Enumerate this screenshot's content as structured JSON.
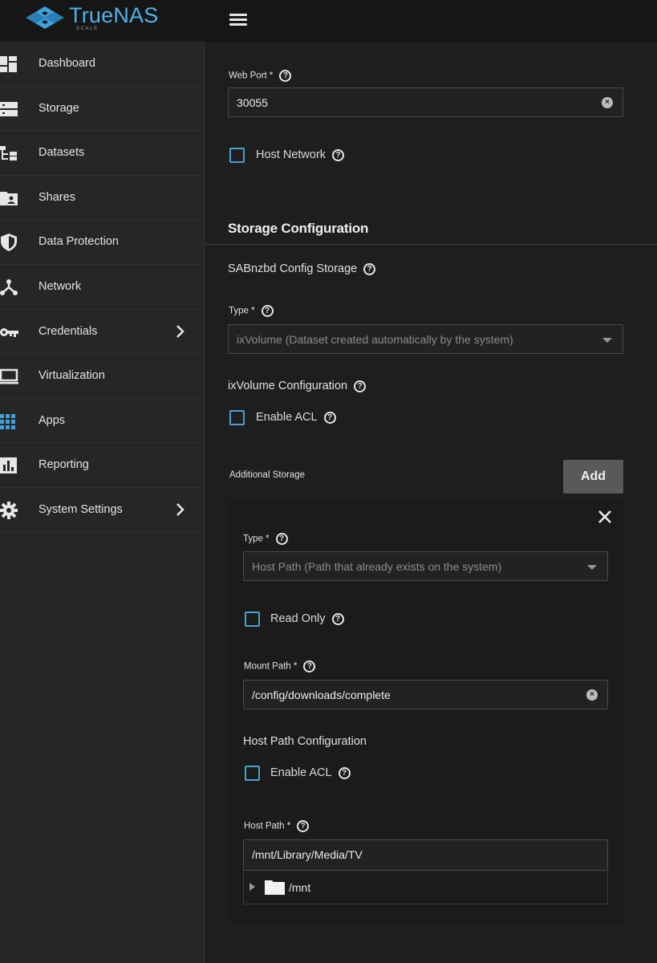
{
  "brand": {
    "name": "TrueNAS",
    "edition": "SCALE",
    "accent": "#4fb1e6"
  },
  "sidebar": {
    "items": [
      {
        "label": "Dashboard",
        "icon": "dashboard-icon"
      },
      {
        "label": "Storage",
        "icon": "storage-icon"
      },
      {
        "label": "Datasets",
        "icon": "datasets-icon"
      },
      {
        "label": "Shares",
        "icon": "shares-folder-icon"
      },
      {
        "label": "Data Protection",
        "icon": "shield-icon"
      },
      {
        "label": "Network",
        "icon": "network-icon"
      },
      {
        "label": "Credentials",
        "icon": "key-icon",
        "has_submenu": true
      },
      {
        "label": "Virtualization",
        "icon": "laptop-icon"
      },
      {
        "label": "Apps",
        "icon": "apps-grid-icon"
      },
      {
        "label": "Reporting",
        "icon": "bar-chart-icon"
      },
      {
        "label": "System Settings",
        "icon": "gear-icon",
        "has_submenu": true
      }
    ]
  },
  "form": {
    "web_port": {
      "label": "Web Port *",
      "value": "30055"
    },
    "host_network": {
      "label": "Host Network",
      "checked": false
    },
    "storage_config": {
      "title": "Storage Configuration",
      "config_storage_label": "SABnzbd Config Storage",
      "type_label": "Type *",
      "type_value": "ixVolume (Dataset created automatically by the system)",
      "ixvolume_label": "ixVolume Configuration",
      "enable_acl_label": "Enable ACL"
    },
    "additional_storage": {
      "label": "Additional Storage",
      "add_button": "Add",
      "item": {
        "type_label": "Type *",
        "type_value": "Host Path (Path that already exists on the system)",
        "read_only_label": "Read Only",
        "mount_path_label": "Mount Path *",
        "mount_path_value": "/config/downloads/complete",
        "host_path_config_label": "Host Path Configuration",
        "enable_acl_label": "Enable ACL",
        "host_path_label": "Host Path *",
        "host_path_value": "/mnt/Library/Media/TV",
        "tree_root": "/mnt"
      }
    }
  }
}
